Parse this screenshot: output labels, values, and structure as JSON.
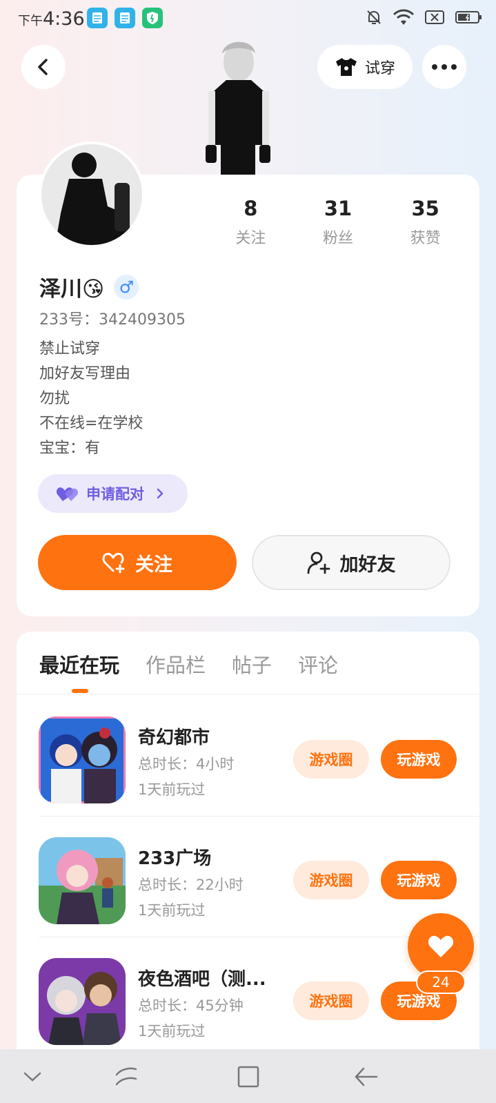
{
  "status_bar": {
    "time_prefix": "下午",
    "time": "4:36",
    "icons": [
      "notes-app-icon",
      "notes-app-icon",
      "security-app-icon",
      "bell-off-icon",
      "wifi-icon",
      "sim-x-icon",
      "battery-icon"
    ]
  },
  "header": {
    "tryon_label": "试穿"
  },
  "profile": {
    "stats": [
      {
        "num": "8",
        "label": "关注"
      },
      {
        "num": "31",
        "label": "粉丝"
      },
      {
        "num": "35",
        "label": "获赞"
      }
    ],
    "name": "泽川😘",
    "gender": "♂",
    "uid": "233号：342409305",
    "bio": [
      "禁止试穿",
      "加好友写理由",
      "勿扰",
      "不在线=在学校",
      "宝宝：有"
    ],
    "pair_label": "申请配对",
    "follow_label": "关注",
    "add_friend_label": "加好友"
  },
  "tabs": [
    "最近在玩",
    "作品栏",
    "帖子",
    "评论"
  ],
  "games": [
    {
      "title": "奇幻都市",
      "duration": "总时长：4小时",
      "last_played": "1天前玩过",
      "circle_label": "游戏圈",
      "play_label": "玩游戏"
    },
    {
      "title": "233广场",
      "duration": "总时长：22小时",
      "last_played": "1天前玩过",
      "circle_label": "游戏圈",
      "play_label": "玩游戏"
    },
    {
      "title": "夜色酒吧（测...",
      "duration": "总时长：45分钟",
      "last_played": "1天前玩过",
      "circle_label": "游戏圈",
      "play_label": "玩游戏"
    }
  ],
  "like": {
    "count": "24"
  },
  "colors": {
    "accent": "#ff7210",
    "pair": "#6f5ee0",
    "gender": "#3d8af7"
  }
}
